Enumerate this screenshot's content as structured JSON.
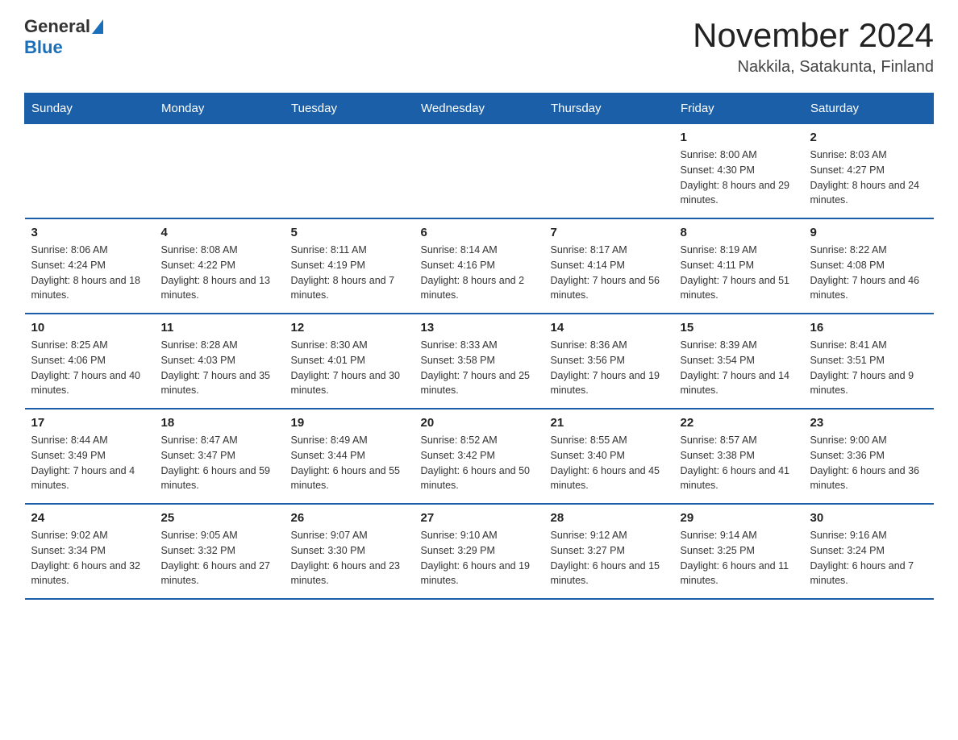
{
  "logo": {
    "general": "General",
    "triangle": "",
    "blue": "Blue"
  },
  "title": "November 2024",
  "subtitle": "Nakkila, Satakunta, Finland",
  "weekdays": [
    "Sunday",
    "Monday",
    "Tuesday",
    "Wednesday",
    "Thursday",
    "Friday",
    "Saturday"
  ],
  "rows": [
    [
      {
        "day": "",
        "info": ""
      },
      {
        "day": "",
        "info": ""
      },
      {
        "day": "",
        "info": ""
      },
      {
        "day": "",
        "info": ""
      },
      {
        "day": "",
        "info": ""
      },
      {
        "day": "1",
        "info": "Sunrise: 8:00 AM\nSunset: 4:30 PM\nDaylight: 8 hours and 29 minutes."
      },
      {
        "day": "2",
        "info": "Sunrise: 8:03 AM\nSunset: 4:27 PM\nDaylight: 8 hours and 24 minutes."
      }
    ],
    [
      {
        "day": "3",
        "info": "Sunrise: 8:06 AM\nSunset: 4:24 PM\nDaylight: 8 hours and 18 minutes."
      },
      {
        "day": "4",
        "info": "Sunrise: 8:08 AM\nSunset: 4:22 PM\nDaylight: 8 hours and 13 minutes."
      },
      {
        "day": "5",
        "info": "Sunrise: 8:11 AM\nSunset: 4:19 PM\nDaylight: 8 hours and 7 minutes."
      },
      {
        "day": "6",
        "info": "Sunrise: 8:14 AM\nSunset: 4:16 PM\nDaylight: 8 hours and 2 minutes."
      },
      {
        "day": "7",
        "info": "Sunrise: 8:17 AM\nSunset: 4:14 PM\nDaylight: 7 hours and 56 minutes."
      },
      {
        "day": "8",
        "info": "Sunrise: 8:19 AM\nSunset: 4:11 PM\nDaylight: 7 hours and 51 minutes."
      },
      {
        "day": "9",
        "info": "Sunrise: 8:22 AM\nSunset: 4:08 PM\nDaylight: 7 hours and 46 minutes."
      }
    ],
    [
      {
        "day": "10",
        "info": "Sunrise: 8:25 AM\nSunset: 4:06 PM\nDaylight: 7 hours and 40 minutes."
      },
      {
        "day": "11",
        "info": "Sunrise: 8:28 AM\nSunset: 4:03 PM\nDaylight: 7 hours and 35 minutes."
      },
      {
        "day": "12",
        "info": "Sunrise: 8:30 AM\nSunset: 4:01 PM\nDaylight: 7 hours and 30 minutes."
      },
      {
        "day": "13",
        "info": "Sunrise: 8:33 AM\nSunset: 3:58 PM\nDaylight: 7 hours and 25 minutes."
      },
      {
        "day": "14",
        "info": "Sunrise: 8:36 AM\nSunset: 3:56 PM\nDaylight: 7 hours and 19 minutes."
      },
      {
        "day": "15",
        "info": "Sunrise: 8:39 AM\nSunset: 3:54 PM\nDaylight: 7 hours and 14 minutes."
      },
      {
        "day": "16",
        "info": "Sunrise: 8:41 AM\nSunset: 3:51 PM\nDaylight: 7 hours and 9 minutes."
      }
    ],
    [
      {
        "day": "17",
        "info": "Sunrise: 8:44 AM\nSunset: 3:49 PM\nDaylight: 7 hours and 4 minutes."
      },
      {
        "day": "18",
        "info": "Sunrise: 8:47 AM\nSunset: 3:47 PM\nDaylight: 6 hours and 59 minutes."
      },
      {
        "day": "19",
        "info": "Sunrise: 8:49 AM\nSunset: 3:44 PM\nDaylight: 6 hours and 55 minutes."
      },
      {
        "day": "20",
        "info": "Sunrise: 8:52 AM\nSunset: 3:42 PM\nDaylight: 6 hours and 50 minutes."
      },
      {
        "day": "21",
        "info": "Sunrise: 8:55 AM\nSunset: 3:40 PM\nDaylight: 6 hours and 45 minutes."
      },
      {
        "day": "22",
        "info": "Sunrise: 8:57 AM\nSunset: 3:38 PM\nDaylight: 6 hours and 41 minutes."
      },
      {
        "day": "23",
        "info": "Sunrise: 9:00 AM\nSunset: 3:36 PM\nDaylight: 6 hours and 36 minutes."
      }
    ],
    [
      {
        "day": "24",
        "info": "Sunrise: 9:02 AM\nSunset: 3:34 PM\nDaylight: 6 hours and 32 minutes."
      },
      {
        "day": "25",
        "info": "Sunrise: 9:05 AM\nSunset: 3:32 PM\nDaylight: 6 hours and 27 minutes."
      },
      {
        "day": "26",
        "info": "Sunrise: 9:07 AM\nSunset: 3:30 PM\nDaylight: 6 hours and 23 minutes."
      },
      {
        "day": "27",
        "info": "Sunrise: 9:10 AM\nSunset: 3:29 PM\nDaylight: 6 hours and 19 minutes."
      },
      {
        "day": "28",
        "info": "Sunrise: 9:12 AM\nSunset: 3:27 PM\nDaylight: 6 hours and 15 minutes."
      },
      {
        "day": "29",
        "info": "Sunrise: 9:14 AM\nSunset: 3:25 PM\nDaylight: 6 hours and 11 minutes."
      },
      {
        "day": "30",
        "info": "Sunrise: 9:16 AM\nSunset: 3:24 PM\nDaylight: 6 hours and 7 minutes."
      }
    ]
  ]
}
